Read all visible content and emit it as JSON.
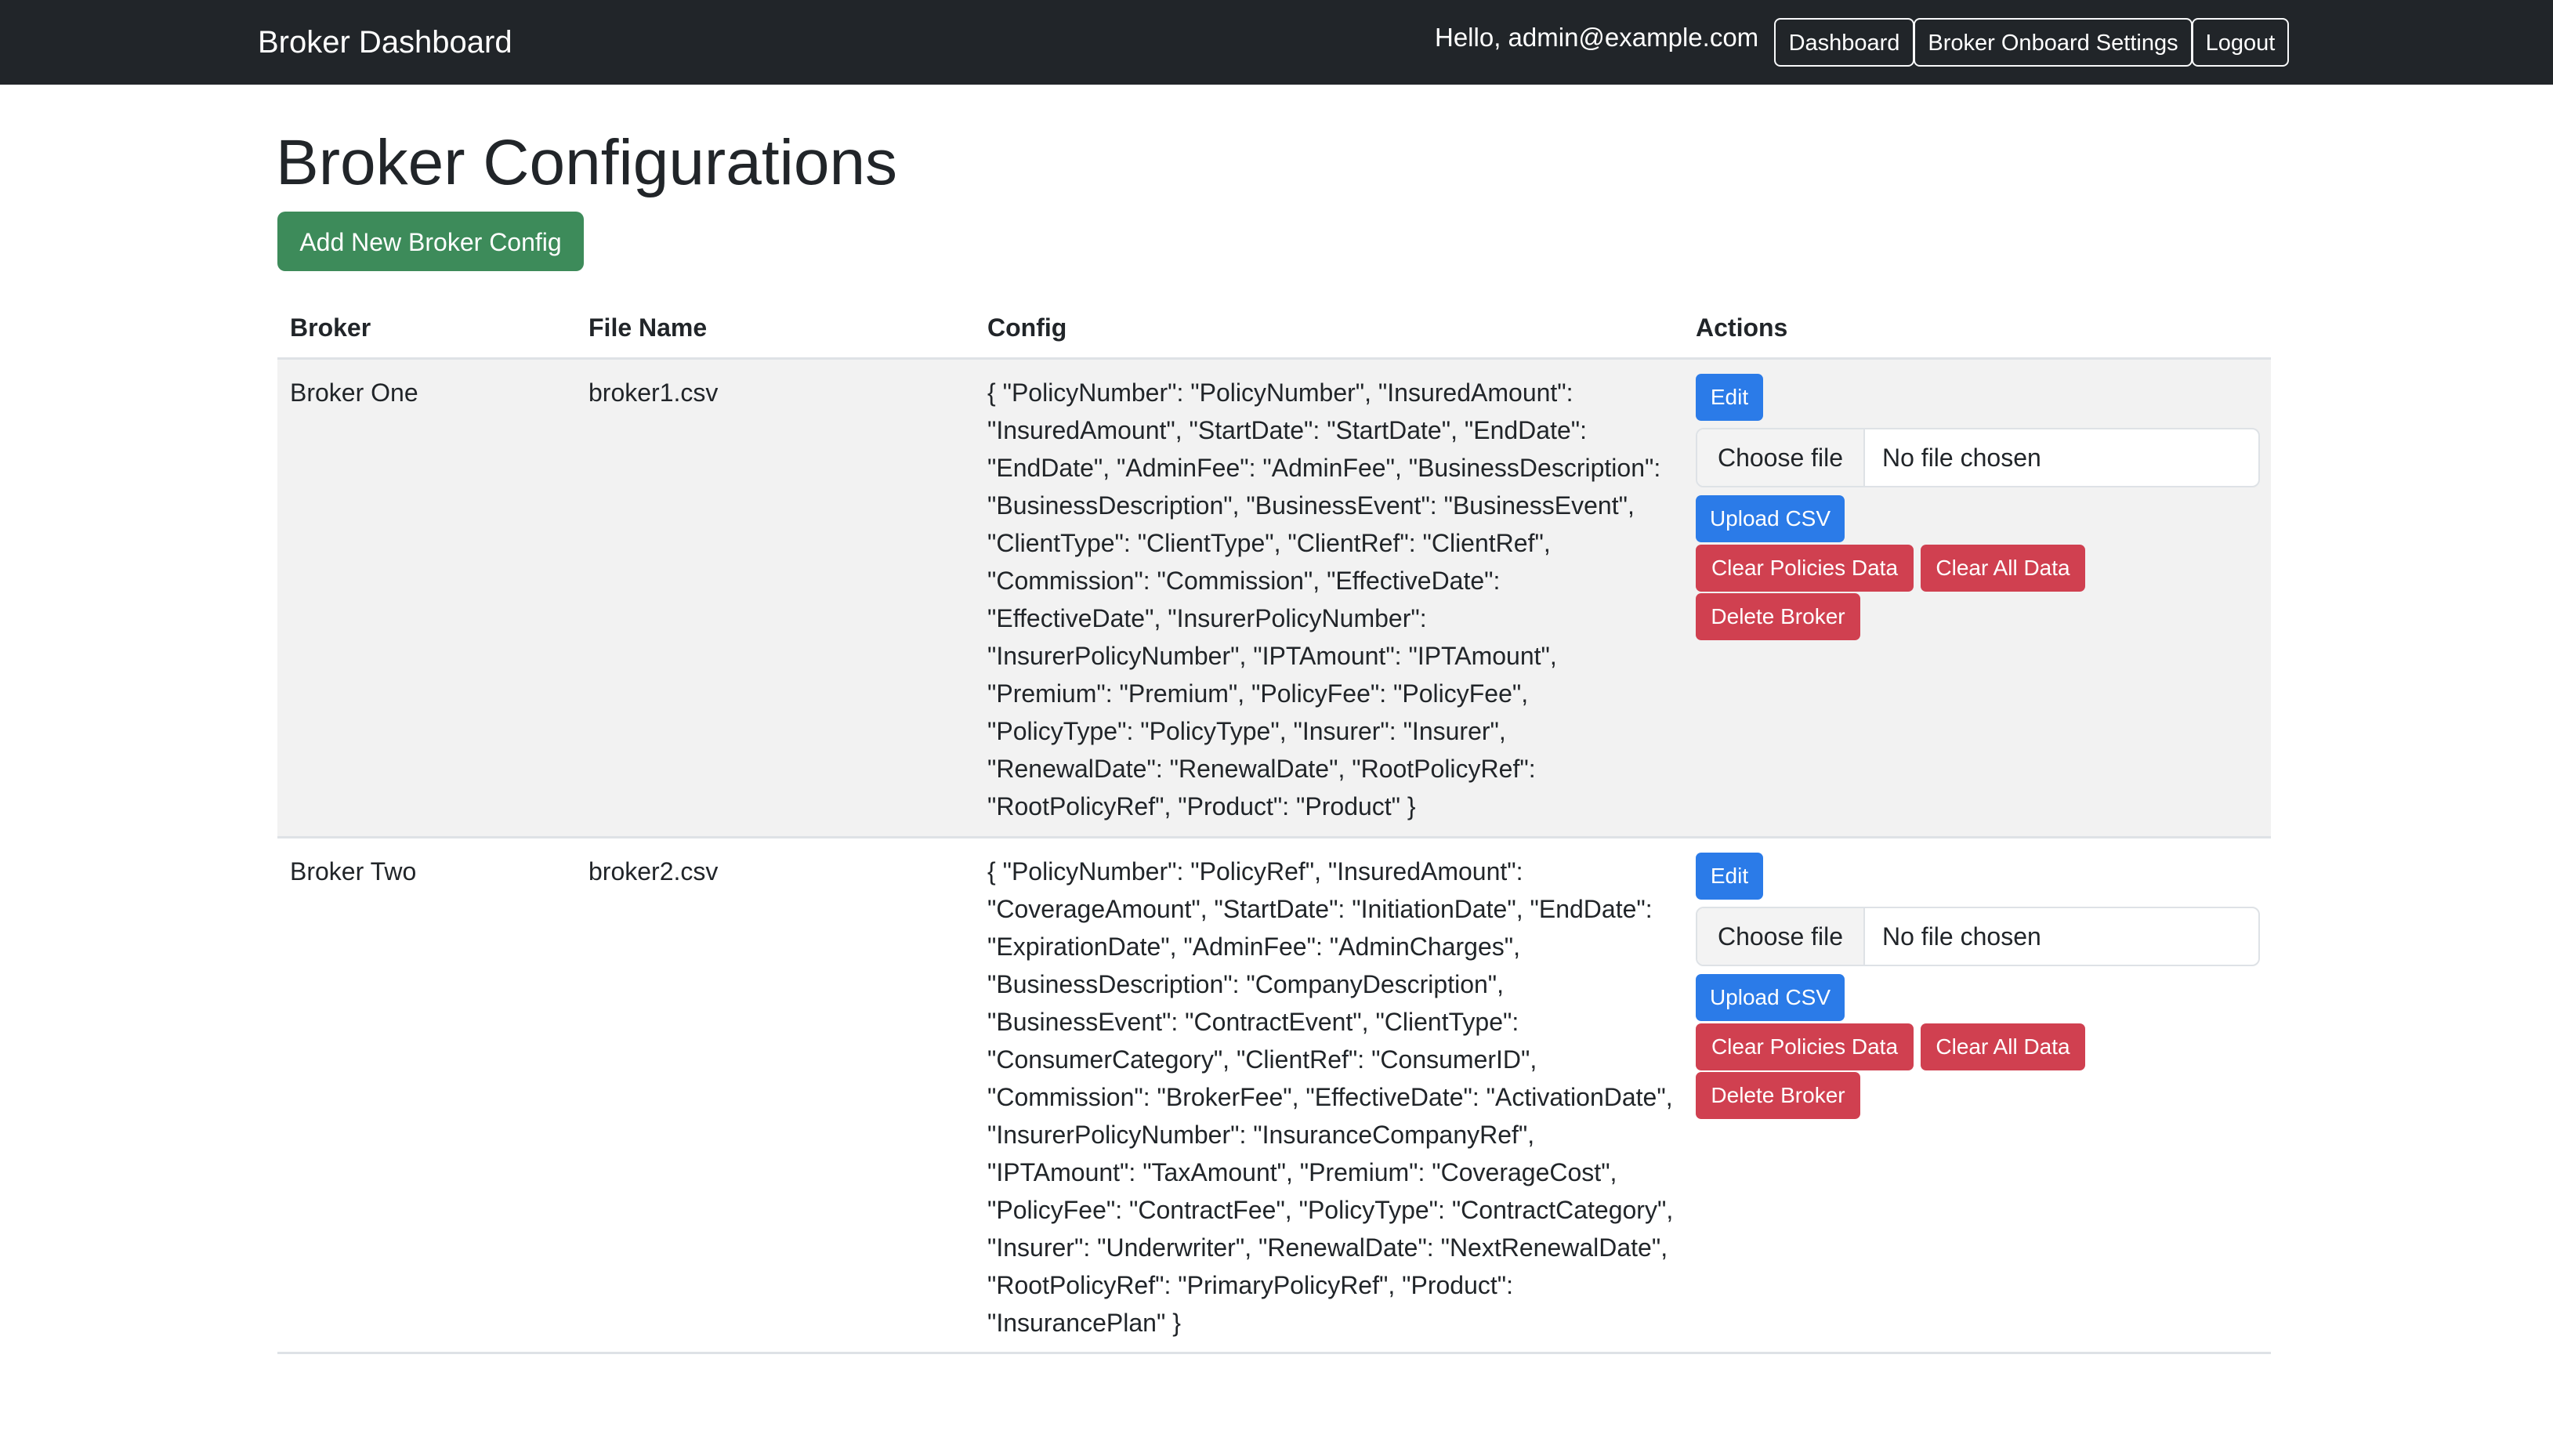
{
  "navbar": {
    "brand": "Broker Dashboard",
    "greeting": "Hello, admin@example.com",
    "links": {
      "dashboard": "Dashboard",
      "onboard_settings": "Broker Onboard Settings",
      "logout": "Logout"
    }
  },
  "page": {
    "title": "Broker Configurations",
    "add_button": "Add New Broker Config"
  },
  "table": {
    "headers": {
      "broker": "Broker",
      "file_name": "File Name",
      "config": "Config",
      "actions": "Actions"
    },
    "rows": [
      {
        "broker": "Broker One",
        "file_name": "broker1.csv",
        "config": "{ \"PolicyNumber\": \"PolicyNumber\", \"InsuredAmount\": \"InsuredAmount\", \"StartDate\": \"StartDate\", \"EndDate\": \"EndDate\", \"AdminFee\": \"AdminFee\", \"BusinessDescription\": \"BusinessDescription\", \"BusinessEvent\": \"BusinessEvent\", \"ClientType\": \"ClientType\", \"ClientRef\": \"ClientRef\", \"Commission\": \"Commission\", \"EffectiveDate\": \"EffectiveDate\", \"InsurerPolicyNumber\": \"InsurerPolicyNumber\", \"IPTAmount\": \"IPTAmount\", \"Premium\": \"Premium\", \"PolicyFee\": \"PolicyFee\", \"PolicyType\": \"PolicyType\", \"Insurer\": \"Insurer\", \"RenewalDate\": \"RenewalDate\", \"RootPolicyRef\": \"RootPolicyRef\", \"Product\": \"Product\" }",
        "actions": {
          "edit": "Edit",
          "choose_file": "Choose file",
          "no_file": "No file chosen",
          "upload": "Upload CSV",
          "clear_policies": "Clear Policies Data",
          "clear_all": "Clear All Data",
          "delete": "Delete Broker"
        }
      },
      {
        "broker": "Broker Two",
        "file_name": "broker2.csv",
        "config": "{ \"PolicyNumber\": \"PolicyRef\", \"InsuredAmount\": \"CoverageAmount\", \"StartDate\": \"InitiationDate\", \"EndDate\": \"ExpirationDate\", \"AdminFee\": \"AdminCharges\", \"BusinessDescription\": \"CompanyDescription\", \"BusinessEvent\": \"ContractEvent\", \"ClientType\": \"ConsumerCategory\", \"ClientRef\": \"ConsumerID\", \"Commission\": \"BrokerFee\", \"EffectiveDate\": \"ActivationDate\", \"InsurerPolicyNumber\": \"InsuranceCompanyRef\", \"IPTAmount\": \"TaxAmount\", \"Premium\": \"CoverageCost\", \"PolicyFee\": \"ContractFee\", \"PolicyType\": \"ContractCategory\", \"Insurer\": \"Underwriter\", \"RenewalDate\": \"NextRenewalDate\", \"RootPolicyRef\": \"PrimaryPolicyRef\", \"Product\": \"InsurancePlan\" }",
        "actions": {
          "edit": "Edit",
          "choose_file": "Choose file",
          "no_file": "No file chosen",
          "upload": "Upload CSV",
          "clear_policies": "Clear Policies Data",
          "clear_all": "Clear All Data",
          "delete": "Delete Broker"
        }
      }
    ]
  },
  "colors": {
    "navbar_bg": "#212529",
    "success": "#3d8b5a",
    "primary": "#2b7be8",
    "danger": "#d04050",
    "striped_row": "#f2f2f2"
  }
}
